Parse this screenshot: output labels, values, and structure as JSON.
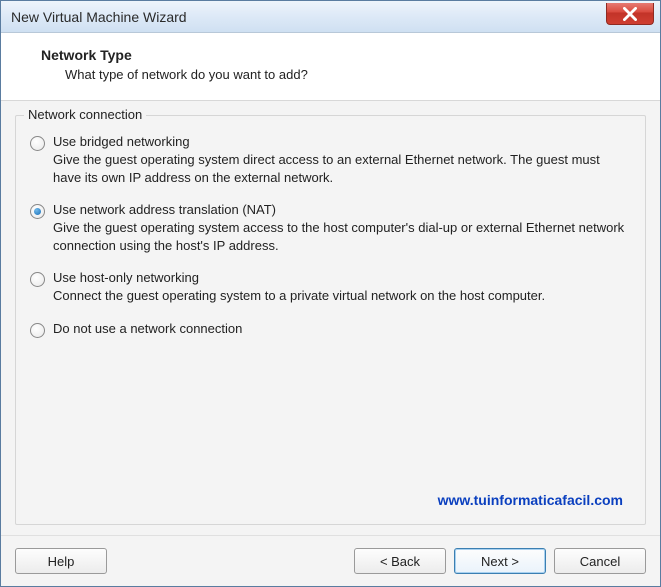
{
  "window": {
    "title": "New Virtual Machine Wizard"
  },
  "header": {
    "title": "Network Type",
    "subtitle": "What type of network do you want to add?"
  },
  "group": {
    "legend": "Network connection"
  },
  "options": {
    "bridged": {
      "label": "Use bridged networking",
      "desc": "Give the guest operating system direct access to an external Ethernet network. The guest must have its own IP address on the external network.",
      "selected": false
    },
    "nat": {
      "label": "Use network address translation (NAT)",
      "desc": "Give the guest operating system access to the host computer's dial-up or external Ethernet network connection using the host's IP address.",
      "selected": true
    },
    "hostonly": {
      "label": "Use host-only networking",
      "desc": "Connect the guest operating system to a private virtual network on the host computer.",
      "selected": false
    },
    "none": {
      "label": "Do not use a network connection",
      "selected": false
    }
  },
  "watermark": "www.tuinformaticafacil.com",
  "buttons": {
    "help": "Help",
    "back": "< Back",
    "next": "Next >",
    "cancel": "Cancel"
  }
}
